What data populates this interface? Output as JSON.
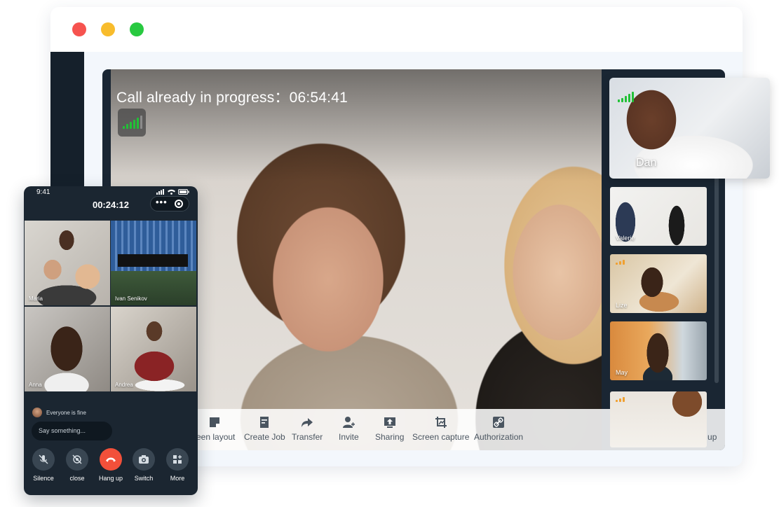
{
  "desktop": {
    "call_status": "Call already in progress：06:54:41",
    "toolbar": [
      {
        "id": "screen-layout",
        "label": "reen layout",
        "icon": "layout-icon"
      },
      {
        "id": "create-job",
        "label": "Create Job",
        "icon": "document-icon"
      },
      {
        "id": "transfer",
        "label": "Transfer",
        "icon": "forward-arrow-icon"
      },
      {
        "id": "invite",
        "label": "Invite",
        "icon": "add-person-icon"
      },
      {
        "id": "sharing",
        "label": "Sharing",
        "icon": "upload-screen-icon"
      },
      {
        "id": "screen-capture",
        "label": "Screen capture",
        "icon": "capture-icon"
      },
      {
        "id": "authorization",
        "label": "Authorization",
        "icon": "link-icon"
      },
      {
        "id": "hang-up",
        "label": "Hang up",
        "icon": "phone-hangup-icon"
      }
    ],
    "popout": {
      "name": "Dan"
    },
    "participants": [
      {
        "name": "Valerie"
      },
      {
        "name": "Lize"
      },
      {
        "name": "May"
      },
      {
        "name": ""
      }
    ]
  },
  "phone": {
    "clock": "9:41",
    "timer": "00:24:12",
    "more_label": "•••",
    "tiles": [
      {
        "name": "Maria"
      },
      {
        "name": "Ivan Senikov"
      },
      {
        "name": "Anna"
      },
      {
        "name": "Andrea"
      }
    ],
    "message": {
      "text": "Everyone is fine"
    },
    "input_placeholder": "Say something...",
    "buttons": [
      {
        "label": "Silence",
        "icon": "mic-off-icon"
      },
      {
        "label": "close",
        "icon": "camera-off-icon"
      },
      {
        "label": "Hang up",
        "icon": "phone-hangup-icon"
      },
      {
        "label": "Switch",
        "icon": "camera-switch-icon"
      },
      {
        "label": "More",
        "icon": "grid-plus-icon"
      }
    ]
  },
  "colors": {
    "signal": "#21c136",
    "hangup_red": "#f2503a",
    "window_bg": "#f3f7fc",
    "call_bg": "#1a2633"
  }
}
